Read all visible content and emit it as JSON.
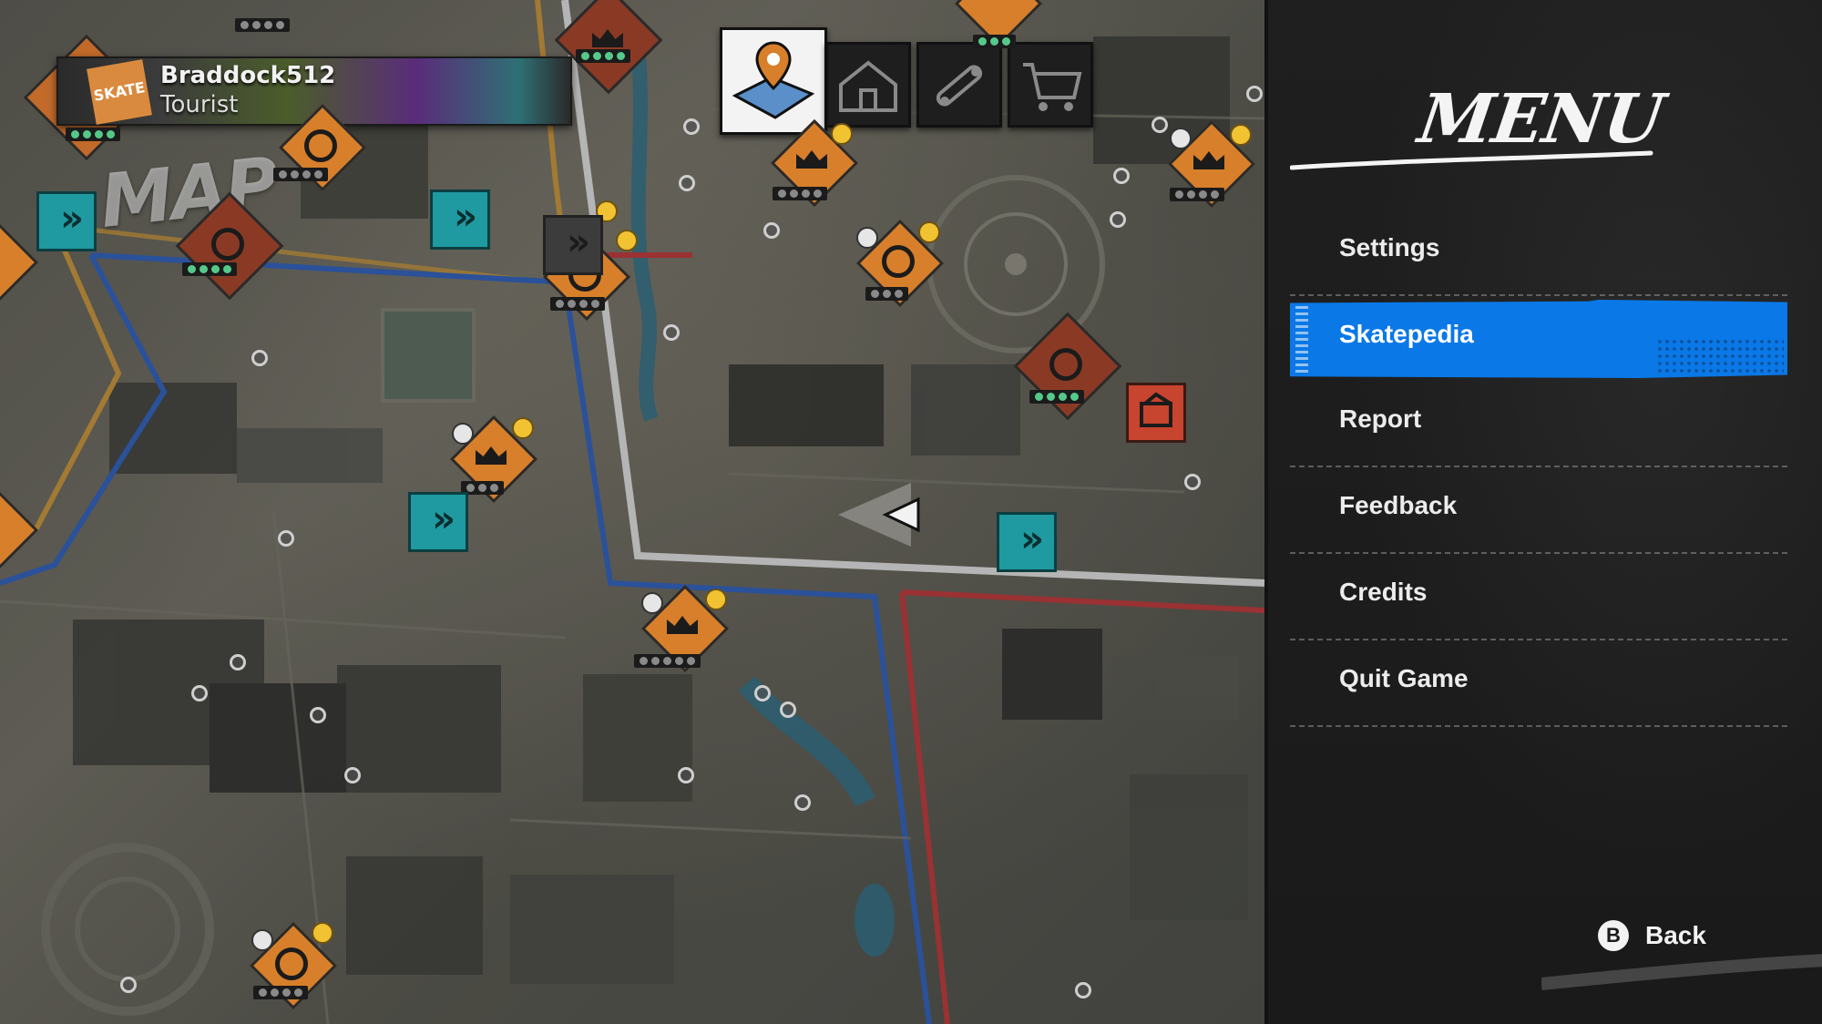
{
  "map": {
    "title": "MAP",
    "player": {
      "name": "Braddock512",
      "rank": "Tourist",
      "badge_text": "SKATE",
      "pips": [
        1,
        1,
        1,
        1
      ]
    },
    "tabs": [
      {
        "name": "map",
        "icon": "map-pin-icon",
        "active": true
      },
      {
        "name": "home",
        "icon": "house-icon",
        "active": false
      },
      {
        "name": "skate",
        "icon": "skateboard-icon",
        "active": false
      },
      {
        "name": "shop",
        "icon": "shopping-cart-icon",
        "active": false
      }
    ]
  },
  "menu": {
    "title": "MENU",
    "items": [
      {
        "label": "Settings",
        "selected": false
      },
      {
        "label": "Skatepedia",
        "selected": true
      },
      {
        "label": "Report",
        "selected": false
      },
      {
        "label": "Feedback",
        "selected": false
      },
      {
        "label": "Credits",
        "selected": false
      },
      {
        "label": "Quit Game",
        "selected": false
      }
    ],
    "back": {
      "button": "B",
      "label": "Back"
    }
  },
  "colors": {
    "menu_highlight": "#0a78e6",
    "marker_orange": "#d77f2a",
    "fast_travel_teal": "#1f9aa0",
    "pip_on": "#56c98a"
  }
}
